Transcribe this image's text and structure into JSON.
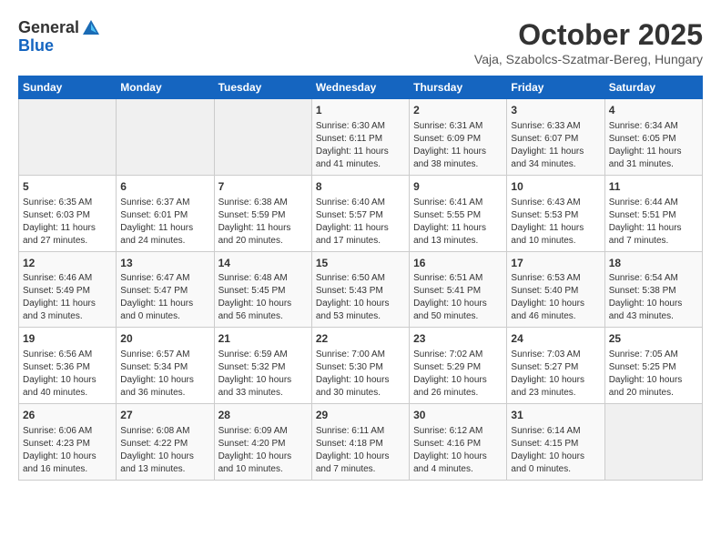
{
  "header": {
    "logo_line1": "General",
    "logo_line2": "Blue",
    "month": "October 2025",
    "location": "Vaja, Szabolcs-Szatmar-Bereg, Hungary"
  },
  "weekdays": [
    "Sunday",
    "Monday",
    "Tuesday",
    "Wednesday",
    "Thursday",
    "Friday",
    "Saturday"
  ],
  "weeks": [
    [
      {
        "day": "",
        "info": ""
      },
      {
        "day": "",
        "info": ""
      },
      {
        "day": "",
        "info": ""
      },
      {
        "day": "1",
        "info": "Sunrise: 6:30 AM\nSunset: 6:11 PM\nDaylight: 11 hours\nand 41 minutes."
      },
      {
        "day": "2",
        "info": "Sunrise: 6:31 AM\nSunset: 6:09 PM\nDaylight: 11 hours\nand 38 minutes."
      },
      {
        "day": "3",
        "info": "Sunrise: 6:33 AM\nSunset: 6:07 PM\nDaylight: 11 hours\nand 34 minutes."
      },
      {
        "day": "4",
        "info": "Sunrise: 6:34 AM\nSunset: 6:05 PM\nDaylight: 11 hours\nand 31 minutes."
      }
    ],
    [
      {
        "day": "5",
        "info": "Sunrise: 6:35 AM\nSunset: 6:03 PM\nDaylight: 11 hours\nand 27 minutes."
      },
      {
        "day": "6",
        "info": "Sunrise: 6:37 AM\nSunset: 6:01 PM\nDaylight: 11 hours\nand 24 minutes."
      },
      {
        "day": "7",
        "info": "Sunrise: 6:38 AM\nSunset: 5:59 PM\nDaylight: 11 hours\nand 20 minutes."
      },
      {
        "day": "8",
        "info": "Sunrise: 6:40 AM\nSunset: 5:57 PM\nDaylight: 11 hours\nand 17 minutes."
      },
      {
        "day": "9",
        "info": "Sunrise: 6:41 AM\nSunset: 5:55 PM\nDaylight: 11 hours\nand 13 minutes."
      },
      {
        "day": "10",
        "info": "Sunrise: 6:43 AM\nSunset: 5:53 PM\nDaylight: 11 hours\nand 10 minutes."
      },
      {
        "day": "11",
        "info": "Sunrise: 6:44 AM\nSunset: 5:51 PM\nDaylight: 11 hours\nand 7 minutes."
      }
    ],
    [
      {
        "day": "12",
        "info": "Sunrise: 6:46 AM\nSunset: 5:49 PM\nDaylight: 11 hours\nand 3 minutes."
      },
      {
        "day": "13",
        "info": "Sunrise: 6:47 AM\nSunset: 5:47 PM\nDaylight: 11 hours\nand 0 minutes."
      },
      {
        "day": "14",
        "info": "Sunrise: 6:48 AM\nSunset: 5:45 PM\nDaylight: 10 hours\nand 56 minutes."
      },
      {
        "day": "15",
        "info": "Sunrise: 6:50 AM\nSunset: 5:43 PM\nDaylight: 10 hours\nand 53 minutes."
      },
      {
        "day": "16",
        "info": "Sunrise: 6:51 AM\nSunset: 5:41 PM\nDaylight: 10 hours\nand 50 minutes."
      },
      {
        "day": "17",
        "info": "Sunrise: 6:53 AM\nSunset: 5:40 PM\nDaylight: 10 hours\nand 46 minutes."
      },
      {
        "day": "18",
        "info": "Sunrise: 6:54 AM\nSunset: 5:38 PM\nDaylight: 10 hours\nand 43 minutes."
      }
    ],
    [
      {
        "day": "19",
        "info": "Sunrise: 6:56 AM\nSunset: 5:36 PM\nDaylight: 10 hours\nand 40 minutes."
      },
      {
        "day": "20",
        "info": "Sunrise: 6:57 AM\nSunset: 5:34 PM\nDaylight: 10 hours\nand 36 minutes."
      },
      {
        "day": "21",
        "info": "Sunrise: 6:59 AM\nSunset: 5:32 PM\nDaylight: 10 hours\nand 33 minutes."
      },
      {
        "day": "22",
        "info": "Sunrise: 7:00 AM\nSunset: 5:30 PM\nDaylight: 10 hours\nand 30 minutes."
      },
      {
        "day": "23",
        "info": "Sunrise: 7:02 AM\nSunset: 5:29 PM\nDaylight: 10 hours\nand 26 minutes."
      },
      {
        "day": "24",
        "info": "Sunrise: 7:03 AM\nSunset: 5:27 PM\nDaylight: 10 hours\nand 23 minutes."
      },
      {
        "day": "25",
        "info": "Sunrise: 7:05 AM\nSunset: 5:25 PM\nDaylight: 10 hours\nand 20 minutes."
      }
    ],
    [
      {
        "day": "26",
        "info": "Sunrise: 6:06 AM\nSunset: 4:23 PM\nDaylight: 10 hours\nand 16 minutes."
      },
      {
        "day": "27",
        "info": "Sunrise: 6:08 AM\nSunset: 4:22 PM\nDaylight: 10 hours\nand 13 minutes."
      },
      {
        "day": "28",
        "info": "Sunrise: 6:09 AM\nSunset: 4:20 PM\nDaylight: 10 hours\nand 10 minutes."
      },
      {
        "day": "29",
        "info": "Sunrise: 6:11 AM\nSunset: 4:18 PM\nDaylight: 10 hours\nand 7 minutes."
      },
      {
        "day": "30",
        "info": "Sunrise: 6:12 AM\nSunset: 4:16 PM\nDaylight: 10 hours\nand 4 minutes."
      },
      {
        "day": "31",
        "info": "Sunrise: 6:14 AM\nSunset: 4:15 PM\nDaylight: 10 hours\nand 0 minutes."
      },
      {
        "day": "",
        "info": ""
      }
    ]
  ]
}
